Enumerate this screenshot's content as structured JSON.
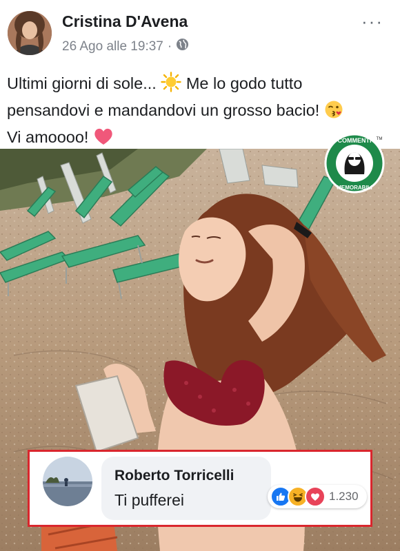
{
  "post": {
    "author": "Cristina D'Avena",
    "date": "26 Ago alle 19:37",
    "separator": "·",
    "text_line1": "Ultimi giorni di sole...",
    "text_line1b": "Me lo godo tutto",
    "text_line2": "pensandovi e mandandovi un grosso bacio!",
    "text_line3": "Vi amoooo!",
    "more_menu": "···"
  },
  "badge": {
    "top_text": "COMMENTI",
    "bottom_text": "MEMORABILI",
    "tm": "TM"
  },
  "comment": {
    "author": "Roberto Torricelli",
    "text": "Ti pufferei",
    "reaction_count": "1.230",
    "reactions": [
      "like-icon",
      "haha-icon",
      "love-icon"
    ]
  },
  "colors": {
    "highlight_border": "#d9262d",
    "like_blue": "#1877f2",
    "haha_yellow": "#f7b125",
    "love_red": "#e84359",
    "badge_green": "#1e8a4a"
  }
}
